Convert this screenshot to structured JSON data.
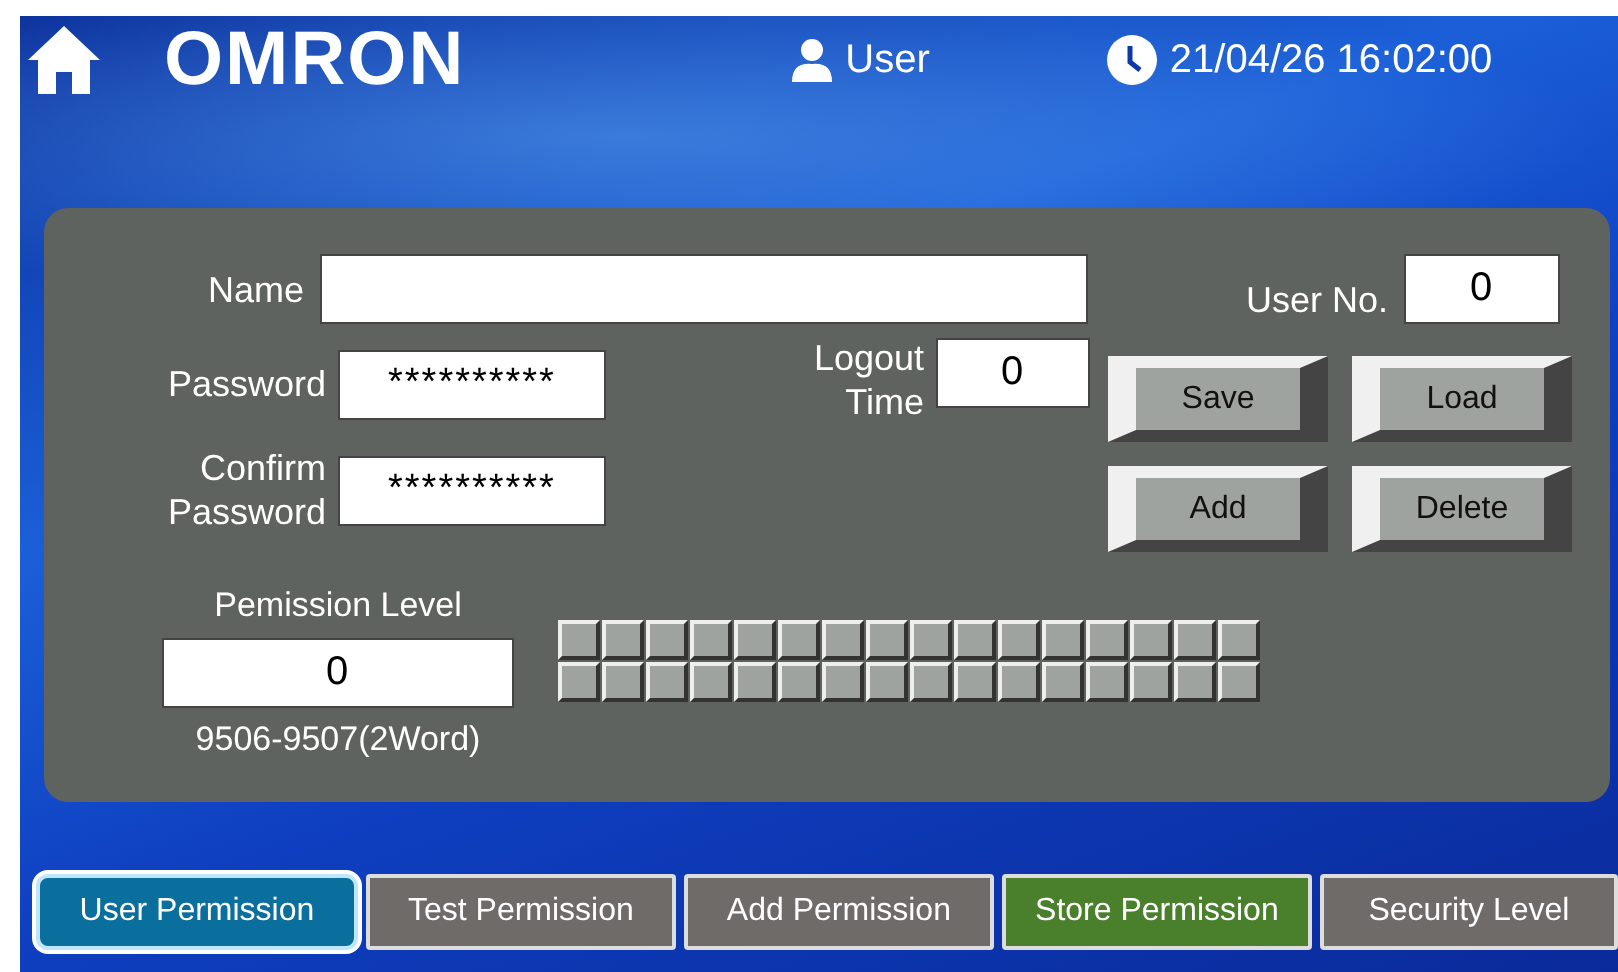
{
  "header": {
    "logo": "OMRON",
    "user": "User",
    "datetime": "21/04/26 16:02:00"
  },
  "form": {
    "name_label": "Name",
    "user_no_label": "User No.",
    "user_no_value": "0",
    "password_label": "Password",
    "password_value": "**********",
    "confirm_label": "Confirm Password",
    "confirm_value": "**********",
    "logout_label": "Logout Time",
    "logout_value": "0",
    "buttons": [
      "Save",
      "Load",
      "Add",
      "Delete"
    ],
    "permission_label": "Pemission Level",
    "permission_value": "0",
    "permission_caption": "9506-9507(2Word)"
  },
  "tabs": [
    {
      "label": "User Permission",
      "selected": true,
      "color": "#0b6f9e"
    },
    {
      "label": "Test Permission",
      "selected": false,
      "color": "#6f6b68"
    },
    {
      "label": "Add Permission",
      "selected": false,
      "color": "#6f6b68"
    },
    {
      "label": "Store Permission",
      "selected": false,
      "color": "#4a7f2c"
    },
    {
      "label": "Security Level",
      "selected": false,
      "color": "#6f6b68"
    }
  ]
}
